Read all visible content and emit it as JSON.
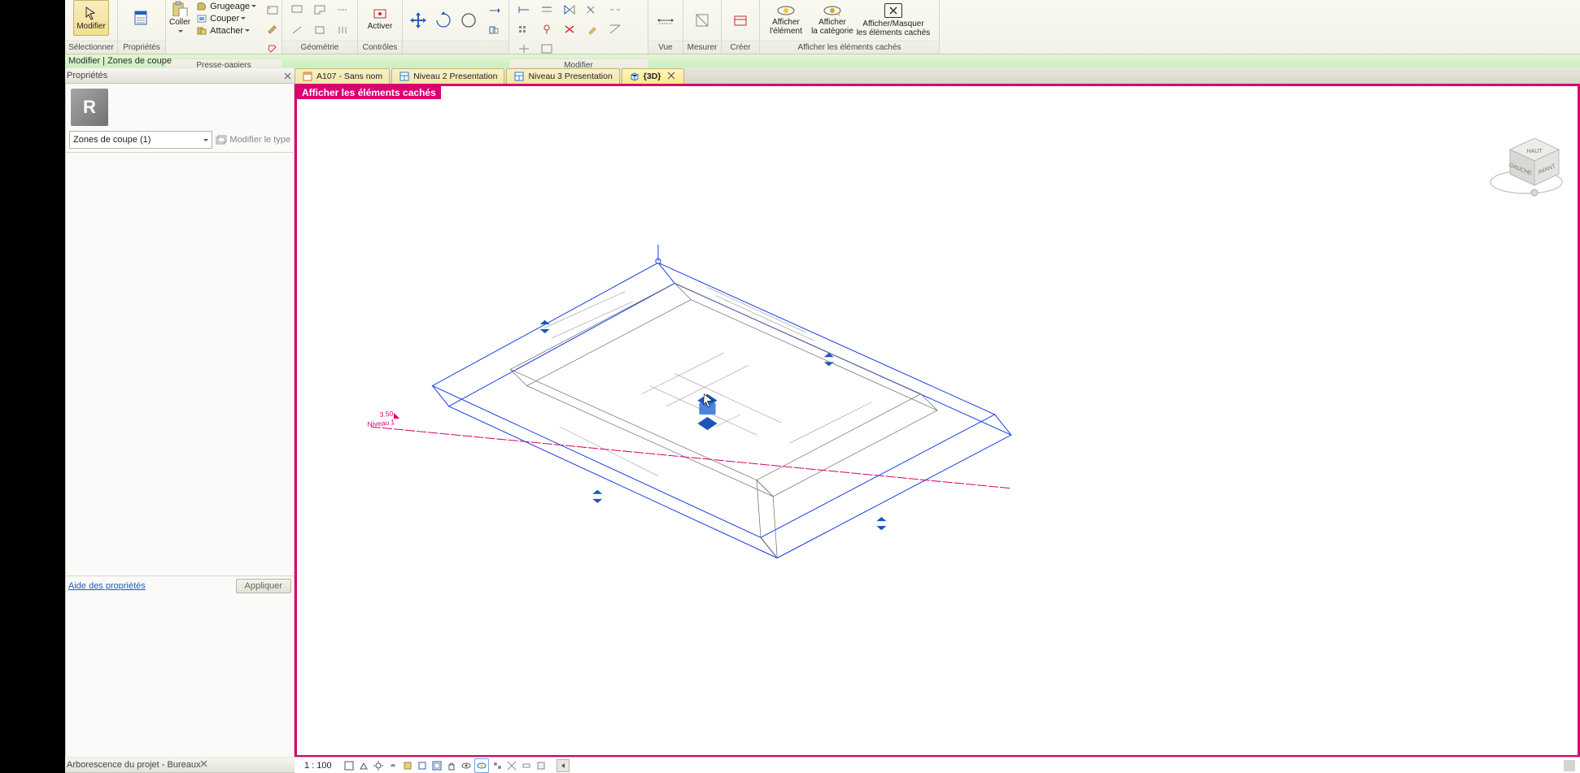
{
  "ribbon": {
    "groups": [
      {
        "label": "Sélectionner"
      },
      {
        "label": "Propriétés"
      },
      {
        "label": "Presse-papiers",
        "paste": "Coller",
        "cut": "Couper",
        "cut_dd": "Grugeage",
        "join": "Attacher"
      },
      {
        "label": "Géométrie"
      },
      {
        "label": "Contrôles",
        "activate": "Activer"
      },
      {
        "label": ""
      },
      {
        "label": "Modifier"
      },
      {
        "label": "Vue"
      },
      {
        "label": "Mesurer"
      },
      {
        "label": "Créer"
      },
      {
        "label": "Afficher les éléments cachés",
        "elem": "Afficher\nl'élément",
        "cat": "Afficher\nla catégorie",
        "toggle": "Afficher/Masquer\nles éléments cachés"
      }
    ],
    "modifier_tab": "Modifier"
  },
  "context_bar": "Modifier | Zones de coupe",
  "properties": {
    "title": "Propriétés",
    "type_combo": "Zones de coupe (1)",
    "edit_type": "Modifier le type",
    "help_link": "Aide des propriétés",
    "apply": "Appliquer"
  },
  "browser": {
    "title": "Arborescence du projet - Bureaux"
  },
  "tabs": [
    {
      "label": "A107 - Sans nom",
      "active": false
    },
    {
      "label": "Niveau 2 Presentation",
      "active": false
    },
    {
      "label": "Niveau 3 Presentation",
      "active": false
    },
    {
      "label": "{3D}",
      "active": true
    }
  ],
  "canvas": {
    "hidden_banner": "Afficher les éléments cachés",
    "level_tag": "Niveau 1",
    "level_val": "3.50"
  },
  "status": {
    "scale": "1 : 100"
  },
  "viewcube": {
    "top": "HAUT",
    "left": "GAUCHE",
    "front": "AVANT"
  }
}
